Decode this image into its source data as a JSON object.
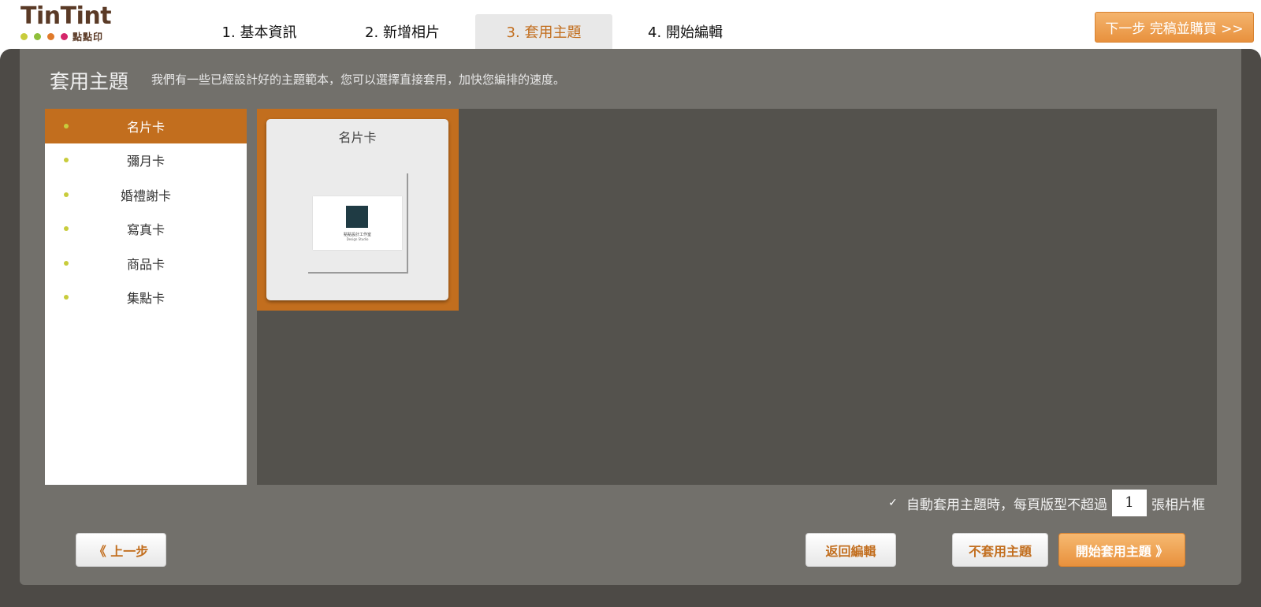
{
  "header": {
    "logo_text": "TinTint",
    "logo_cn": "點點印",
    "logo_dot_colors": [
      "#c8cc3c",
      "#8fbf3a",
      "#e07a2a",
      "#d4266a"
    ],
    "steps": [
      {
        "label": "1. 基本資訊"
      },
      {
        "label": "2. 新增相片"
      },
      {
        "label": "3. 套用主題"
      },
      {
        "label": "4. 開始編輯"
      }
    ],
    "active_step": 3,
    "next_button": "下一步 完稿並購買 >>"
  },
  "main": {
    "title": "套用主題",
    "description": "我們有一些已經設計好的主題範本，您可以選擇直接套用，加快您編排的速度。",
    "categories": [
      {
        "label": "名片卡"
      },
      {
        "label": "彌月卡"
      },
      {
        "label": "婚禮謝卡"
      },
      {
        "label": "寫真卡"
      },
      {
        "label": "商品卡"
      },
      {
        "label": "集點卡"
      }
    ],
    "active_category": 0,
    "themes": [
      {
        "title": "名片卡",
        "thumb_line1": "點點設計工作室",
        "thumb_line2": "Design Studio"
      }
    ],
    "auto_apply": {
      "checked": true,
      "label_before": "自動套用主題時，每頁版型不超過",
      "count": "1",
      "label_after": "張相片框"
    }
  },
  "footer": {
    "prev_button": "《 上一步",
    "back_button": "返回編輯",
    "no_theme_button": "不套用主題",
    "apply_button": "開始套用主題 》"
  },
  "colors": {
    "accent": "#c26e1e",
    "orange_button": "#e8913d",
    "panel": "#72706b",
    "dark": "#4d4a46"
  }
}
